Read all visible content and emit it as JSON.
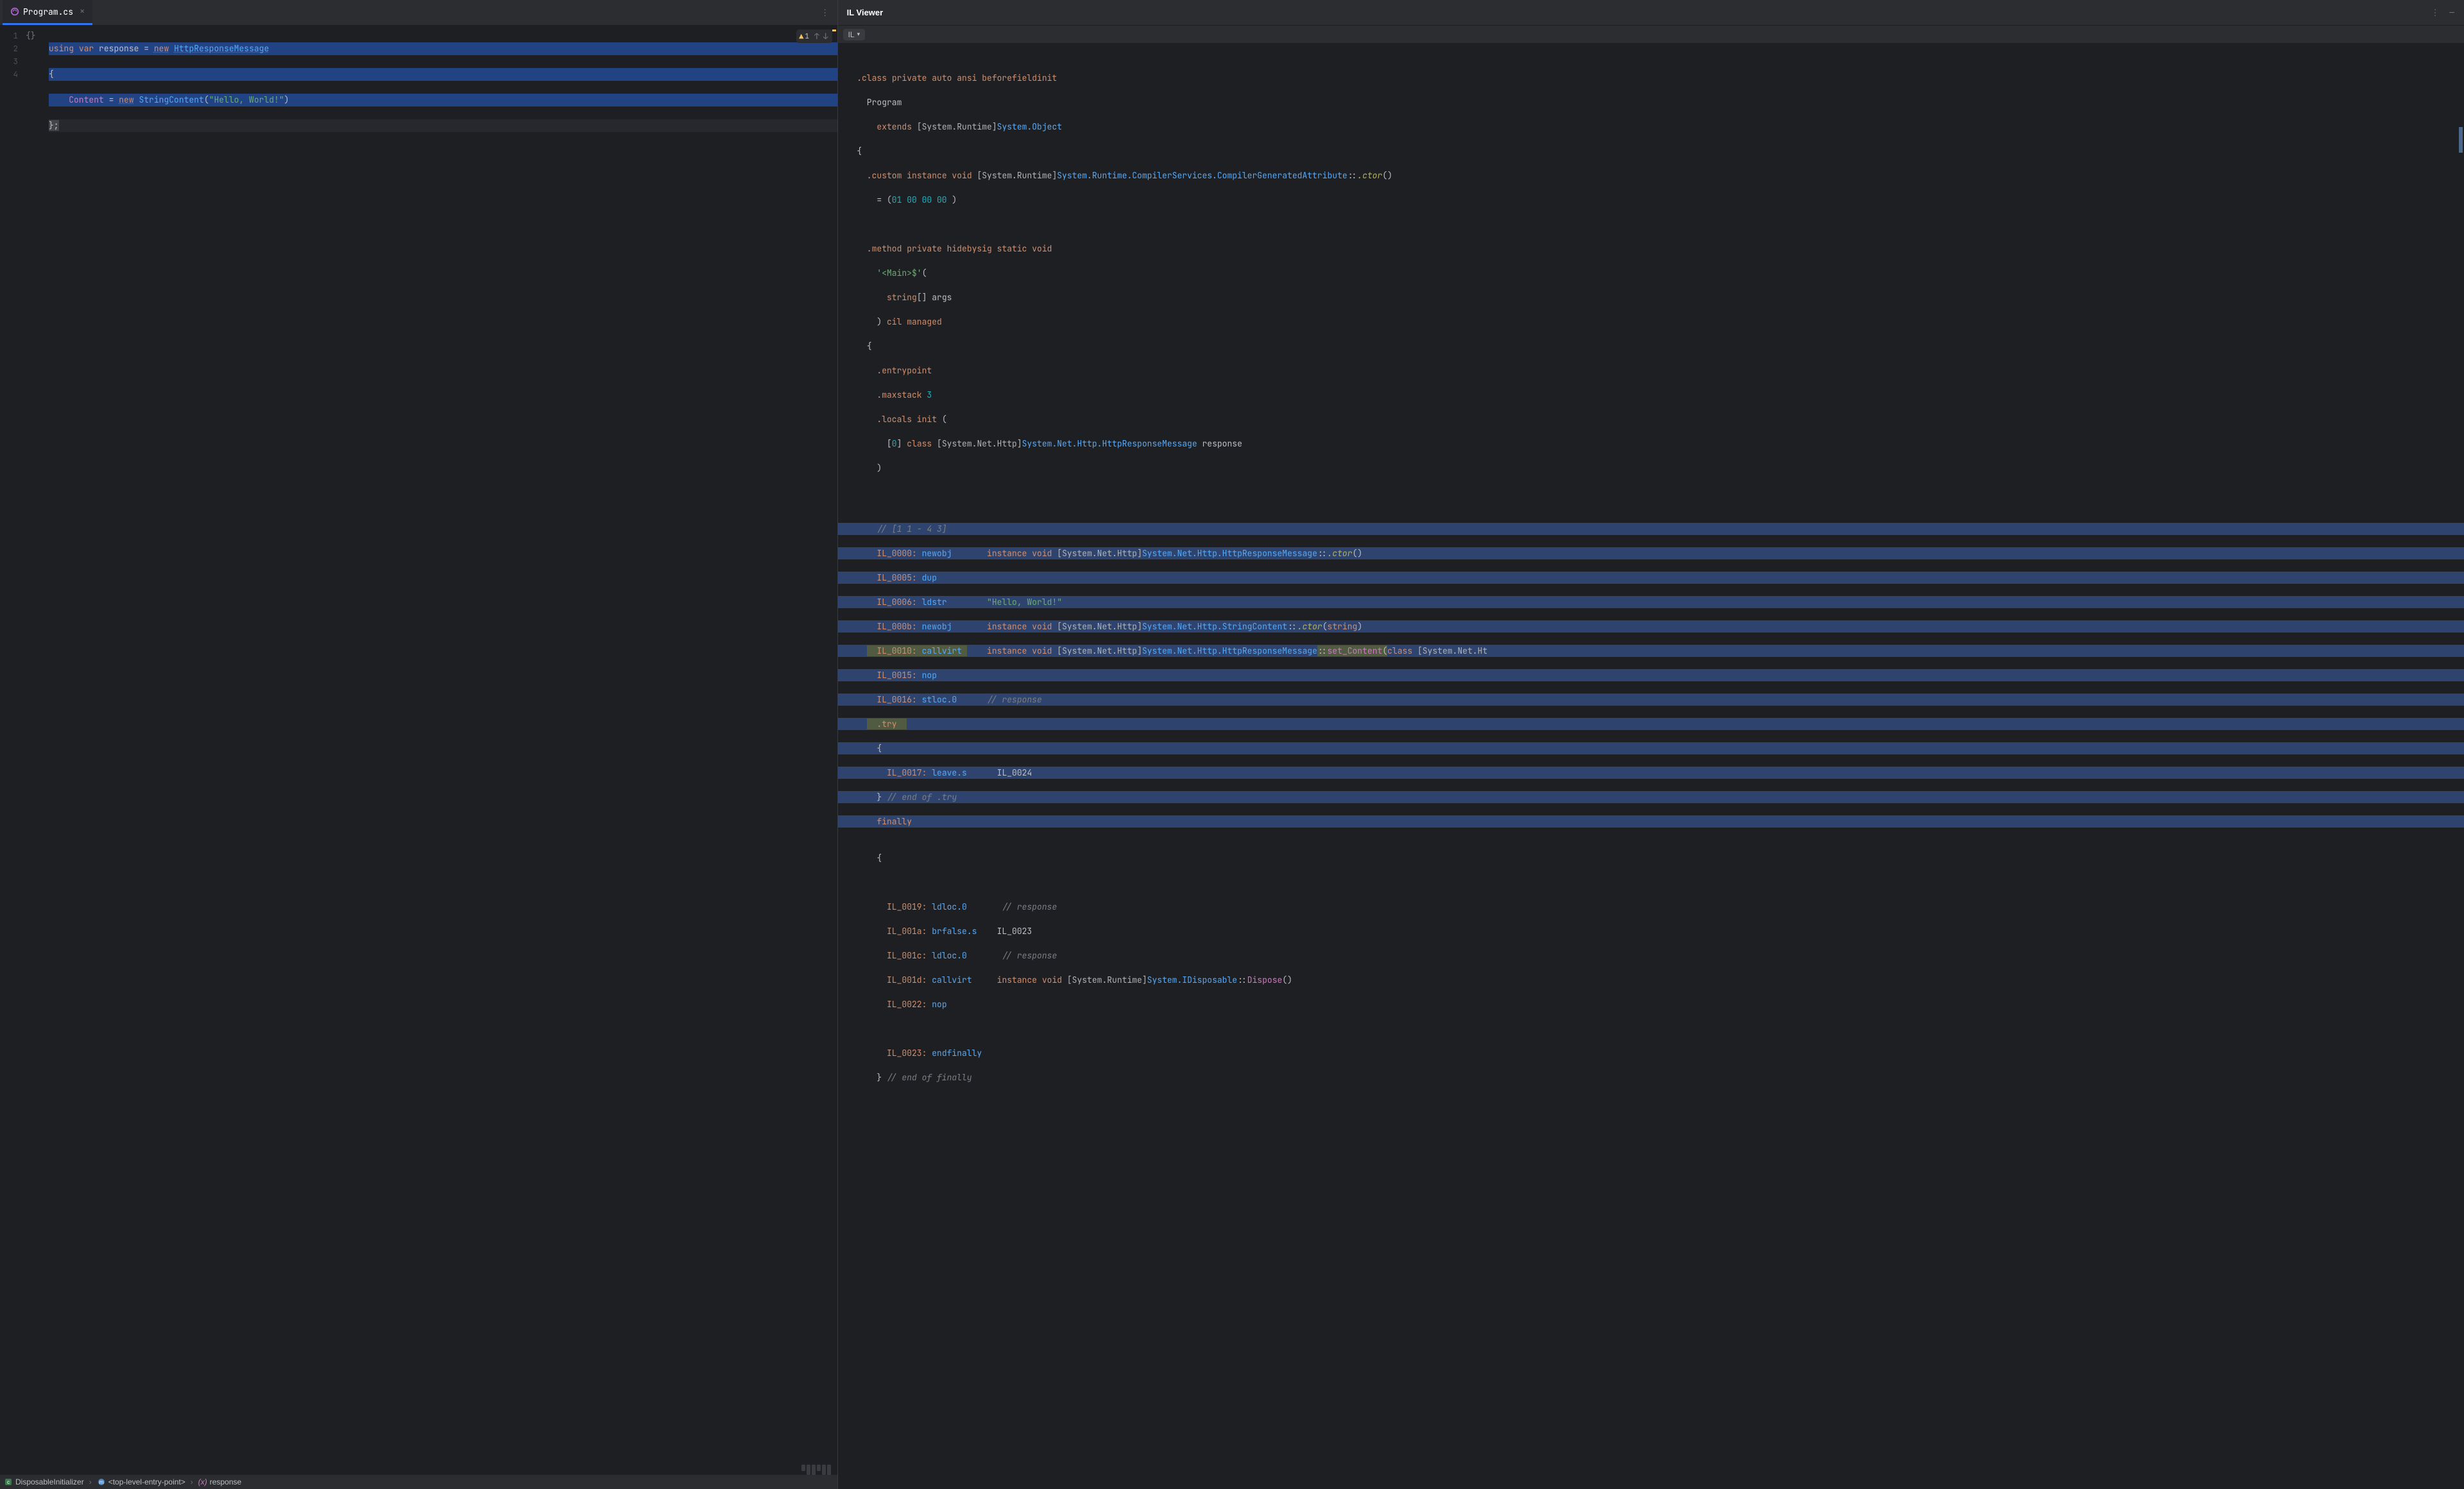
{
  "left": {
    "tab": {
      "filename": "Program.cs"
    },
    "lineNumbers": [
      "1",
      "2",
      "3",
      "4"
    ],
    "fold": "{}",
    "inspection": {
      "warn_count": "1"
    },
    "code": {
      "l1": {
        "kw1": "using",
        "kw2": "var",
        "id": "response",
        "kw3": "new",
        "type": "HttpResponseMessage"
      },
      "l2": {
        "brace": "{"
      },
      "l3": {
        "id": "Content",
        "kw": "new",
        "type": "StringContent",
        "str": "\"Hello, World!\""
      },
      "l4": {
        "brace": "};"
      }
    },
    "breadcrumbs": {
      "bc1": "DisposableInitializer",
      "bc2": "<top-level-entry-point>",
      "bc3": "response"
    }
  },
  "right": {
    "title": "IL Viewer",
    "dropdown": "IL",
    "il": {
      "classDecl": {
        "d": ".class",
        "mods": "private auto ansi beforefieldinit",
        "name": "Program",
        "ext": "extends",
        "ns": "[System.Runtime]",
        "base": "System.Object"
      },
      "custom": {
        "d": ".custom",
        "mods": "instance void",
        "ns": "[System.Runtime]",
        "type": "System.Runtime.CompilerServices.CompilerGeneratedAttribute",
        "ctor": ".ctor",
        "bytes": "01 00 00 00"
      },
      "method": {
        "d": ".method",
        "mods": "private hidebysig static void",
        "name": "'<Main>$'",
        "argtype": "string",
        "argarr": "[] args",
        "cil": "cil managed"
      },
      "entry": ".entrypoint",
      "maxstack": {
        "d": ".maxstack",
        "n": "3"
      },
      "locals": {
        "d": ".locals init",
        "idx": "0",
        "kw": "class",
        "ns": "[System.Net.Http]",
        "type": "System.Net.Http.HttpResponseMessage",
        "var": "response"
      },
      "cmt1": "// [1 1 - 4 3]",
      "i0000": {
        "addr": "IL_0000:",
        "op": "newobj",
        "sig": "instance void",
        "ns": "[System.Net.Http]",
        "type": "System.Net.Http.HttpResponseMessage",
        "ctor": ".ctor"
      },
      "i0005": {
        "addr": "IL_0005:",
        "op": "dup"
      },
      "i0006": {
        "addr": "IL_0006:",
        "op": "ldstr",
        "str": "\"Hello, World!\""
      },
      "i000b": {
        "addr": "IL_000b:",
        "op": "newobj",
        "sig": "instance void",
        "ns": "[System.Net.Http]",
        "type": "System.Net.Http.StringContent",
        "ctor": ".ctor",
        "arg": "string"
      },
      "i0010": {
        "addr": "IL_0010:",
        "op": "callvirt",
        "sig": "instance void",
        "ns": "[System.Net.Http]",
        "type": "System.Net.Http.HttpResponseMessage",
        "m": "set_Content",
        "argkw": "class",
        "argns": "[System.Net.Ht"
      },
      "i0015": {
        "addr": "IL_0015:",
        "op": "nop"
      },
      "i0016": {
        "addr": "IL_0016:",
        "op": "stloc.0",
        "cm": "// response"
      },
      "try": ".try",
      "i0017": {
        "addr": "IL_0017:",
        "op": "leave.s",
        "target": "IL_0024"
      },
      "endtry": "// end of .try",
      "finally": "finally",
      "i0019": {
        "addr": "IL_0019:",
        "op": "ldloc.0",
        "cm": "// response"
      },
      "i001a": {
        "addr": "IL_001a:",
        "op": "brfalse.s",
        "target": "IL_0023"
      },
      "i001c": {
        "addr": "IL_001c:",
        "op": "ldloc.0",
        "cm": "// response"
      },
      "i001d": {
        "addr": "IL_001d:",
        "op": "callvirt",
        "sig": "instance void",
        "ns": "[System.Runtime]",
        "type": "System.IDisposable",
        "m": "Dispose"
      },
      "i0022": {
        "addr": "IL_0022:",
        "op": "nop"
      },
      "i0023": {
        "addr": "IL_0023:",
        "op": "endfinally"
      },
      "endfin": "// end of finally"
    }
  }
}
